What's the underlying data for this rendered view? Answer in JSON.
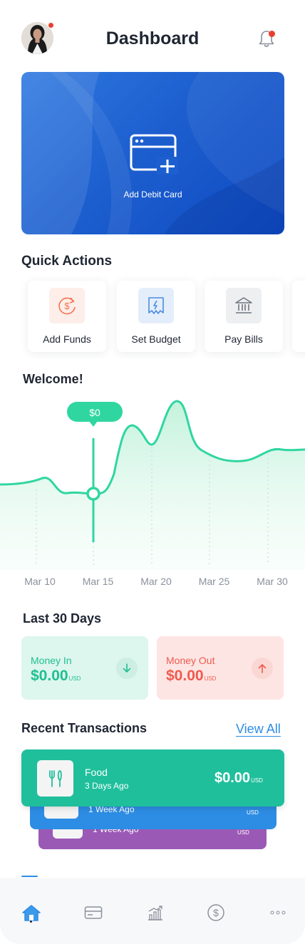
{
  "header": {
    "title": "Dashboard",
    "avatar_icon": "user-avatar",
    "notification_icon": "bell-icon"
  },
  "debit_card": {
    "label": "Add Debit Card",
    "icon": "add-card-icon"
  },
  "quick_actions": {
    "title": "Quick Actions",
    "items": [
      {
        "label": "Add Funds",
        "icon": "dollar-refresh-icon",
        "color": "#f4734e",
        "bg": "#fdeee9"
      },
      {
        "label": "Set Budget",
        "icon": "receipt-icon",
        "color": "#4a8ce0",
        "bg": "#e4eefb"
      },
      {
        "label": "Pay Bills",
        "icon": "bank-icon",
        "color": "#6f7680",
        "bg": "#eeeff1"
      }
    ]
  },
  "welcome": {
    "title": "Welcome!",
    "tooltip_value": "$0"
  },
  "chart_data": {
    "type": "area",
    "categories": [
      "Mar 10",
      "Mar 15",
      "Mar 20",
      "Mar 25",
      "Mar 30"
    ],
    "selected_category": "Mar 15",
    "color": "#2fd6a0"
  },
  "last_30_days": {
    "title": "Last 30 Days",
    "money_in": {
      "label": "Money In",
      "amount": "$0.00",
      "currency": "USD",
      "color": "#1fbf8f",
      "bg": "#ddf6ee",
      "icon": "arrow-down-icon"
    },
    "money_out": {
      "label": "Money Out",
      "amount": "$0.00",
      "currency": "USD",
      "color": "#ee5a4f",
      "bg": "#fde5e3",
      "icon": "arrow-up-icon"
    }
  },
  "recent_transactions": {
    "title": "Recent Transactions",
    "view_all": "View All",
    "items": [
      {
        "name": "Food",
        "time": "3 Days Ago",
        "amount": "$0.00",
        "currency": "USD",
        "color": "#1fbf9c",
        "icon": "utensils-icon"
      },
      {
        "time": "1 Week Ago",
        "currency": "USD",
        "color": "#2d8de4"
      },
      {
        "time": "1 Week Ago",
        "currency": "USD",
        "color": "#9b59b6"
      }
    ]
  },
  "bottom_nav": {
    "items": [
      {
        "icon": "home-icon",
        "active": true
      },
      {
        "icon": "card-icon"
      },
      {
        "icon": "chart-icon"
      },
      {
        "icon": "dollar-icon"
      },
      {
        "icon": "more-icon"
      }
    ]
  }
}
